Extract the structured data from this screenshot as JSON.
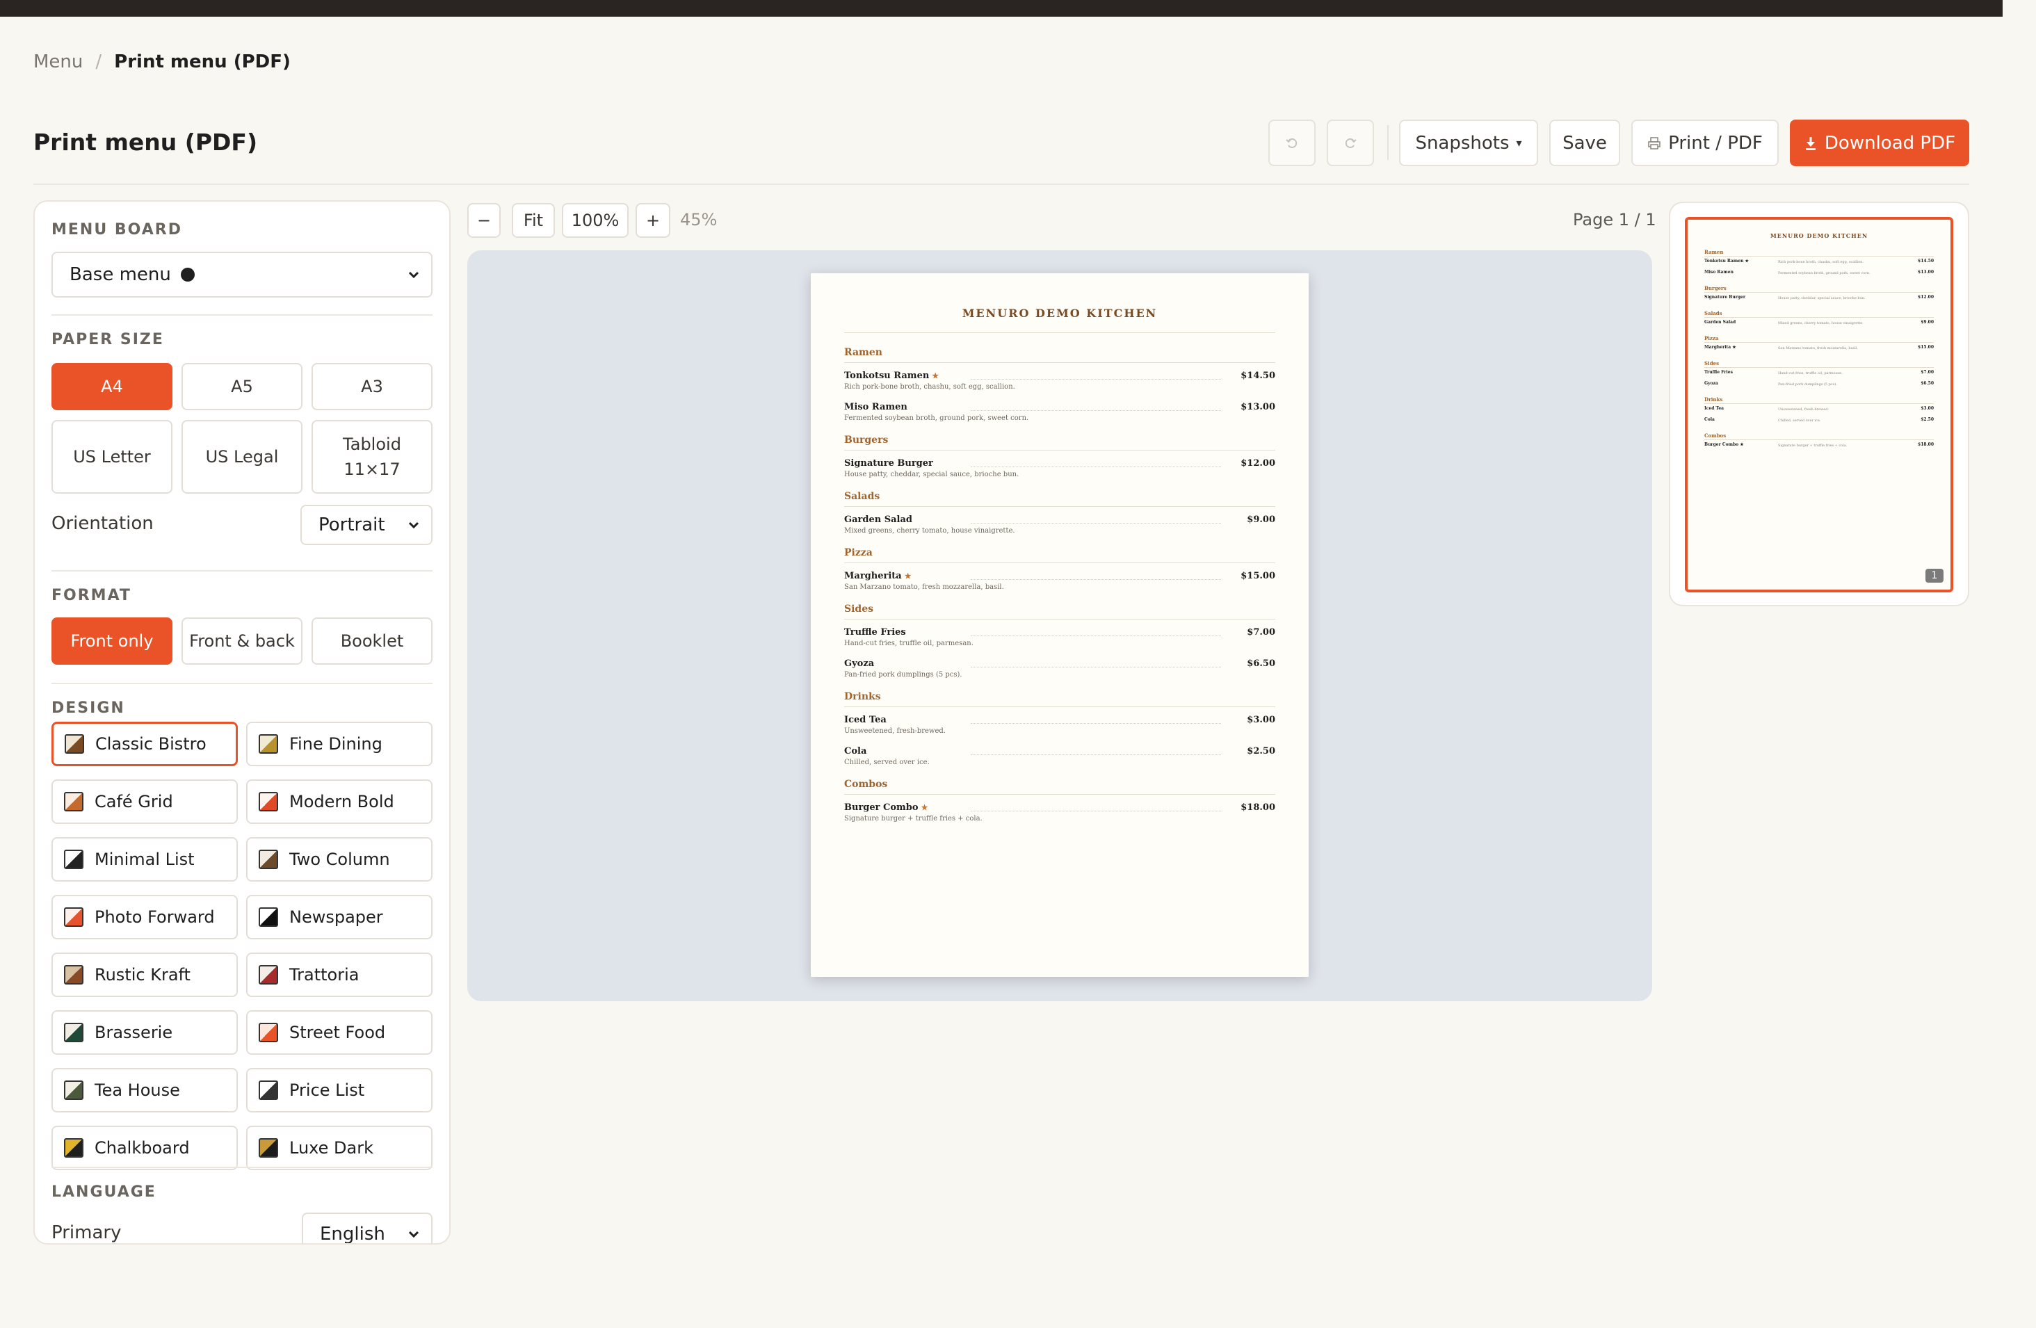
{
  "breadcrumb": {
    "parent": "Menu",
    "separator": "/",
    "current": "Print menu (PDF)"
  },
  "page_title": "Print menu (PDF)",
  "toolbar": {
    "undo_icon": "undo-icon",
    "redo_icon": "redo-icon",
    "snapshots_label": "Snapshots",
    "snapshots_caret": "▾",
    "save_label": "Save",
    "print_label": "Print / PDF",
    "download_label": "Download PDF",
    "accent_color": "#ea5328"
  },
  "sidebar": {
    "menu_board": {
      "label": "MENU BOARD",
      "value": "Base menu"
    },
    "paper_size": {
      "label": "PAPER SIZE",
      "options": [
        "A4",
        "A5",
        "A3",
        "US Letter",
        "US Legal",
        "Tabloid 11×17"
      ],
      "tabloid_line1": "Tabloid",
      "tabloid_line2": "11×17",
      "selected": "A4",
      "orientation_label": "Orientation",
      "orientation_value": "Portrait"
    },
    "format": {
      "label": "FORMAT",
      "options": [
        "Front only",
        "Front & back",
        "Booklet"
      ],
      "selected": "Front only"
    },
    "design": {
      "label": "DESIGN",
      "selected": "Classic Bistro",
      "items": [
        {
          "name": "Classic Bistro",
          "c1": "#7a4a23",
          "c2": "#f1e6d3"
        },
        {
          "name": "Fine Dining",
          "c1": "#b8922c",
          "c2": "#f3ead3"
        },
        {
          "name": "Café Grid",
          "c1": "#c46a2e",
          "c2": "#fbeee0"
        },
        {
          "name": "Modern Bold",
          "c1": "#e24a27",
          "c2": "#fff3ee"
        },
        {
          "name": "Minimal List",
          "c1": "#222222",
          "c2": "#ffffff"
        },
        {
          "name": "Two Column",
          "c1": "#6d4a2a",
          "c2": "#f2ebe1"
        },
        {
          "name": "Photo Forward",
          "c1": "#e6532c",
          "c2": "#fff1ea"
        },
        {
          "name": "Newspaper",
          "c1": "#111111",
          "c2": "#ffffff"
        },
        {
          "name": "Rustic Kraft",
          "c1": "#8b4a26",
          "c2": "#d9c2a2"
        },
        {
          "name": "Trattoria",
          "c1": "#a82b2b",
          "c2": "#f6ece6"
        },
        {
          "name": "Brasserie",
          "c1": "#1f4a38",
          "c2": "#f1ede4"
        },
        {
          "name": "Street Food",
          "c1": "#ea5328",
          "c2": "#fde7dc"
        },
        {
          "name": "Tea House",
          "c1": "#4a5a3a",
          "c2": "#f2efe4"
        },
        {
          "name": "Price List",
          "c1": "#333333",
          "c2": "#ffffff"
        },
        {
          "name": "Chalkboard",
          "c1": "#1f1f1f",
          "c2": "#e0b52b"
        },
        {
          "name": "Luxe Dark",
          "c1": "#1c1c1c",
          "c2": "#c99a3a"
        }
      ]
    },
    "language": {
      "label": "LANGUAGE",
      "primary_label": "Primary",
      "primary_value": "English"
    }
  },
  "preview": {
    "zoom_out": "−",
    "fit": "Fit",
    "zoom_100": "100%",
    "zoom_in": "+",
    "zoom_level": "45%",
    "page_indicator": "Page 1 / 1",
    "thumb_page_number": "1",
    "menu": {
      "title": "MENURO DEMO KITCHEN",
      "sections": [
        {
          "name": "Ramen",
          "items": [
            {
              "name": "Tonkotsu Ramen",
              "star": true,
              "price": "$14.50",
              "desc": "Rich pork-bone broth, chashu, soft egg, scallion."
            },
            {
              "name": "Miso Ramen",
              "star": false,
              "price": "$13.00",
              "desc": "Fermented soybean broth, ground pork, sweet corn."
            }
          ]
        },
        {
          "name": "Burgers",
          "items": [
            {
              "name": "Signature Burger",
              "star": false,
              "price": "$12.00",
              "desc": "House patty, cheddar, special sauce, brioche bun."
            }
          ]
        },
        {
          "name": "Salads",
          "items": [
            {
              "name": "Garden Salad",
              "star": false,
              "price": "$9.00",
              "desc": "Mixed greens, cherry tomato, house vinaigrette."
            }
          ]
        },
        {
          "name": "Pizza",
          "items": [
            {
              "name": "Margherita",
              "star": true,
              "price": "$15.00",
              "desc": "San Marzano tomato, fresh mozzarella, basil."
            }
          ]
        },
        {
          "name": "Sides",
          "items": [
            {
              "name": "Truffle Fries",
              "star": false,
              "price": "$7.00",
              "desc": "Hand-cut fries, truffle oil, parmesan."
            },
            {
              "name": "Gyoza",
              "star": false,
              "price": "$6.50",
              "desc": "Pan-fried pork dumplings (5 pcs)."
            }
          ]
        },
        {
          "name": "Drinks",
          "items": [
            {
              "name": "Iced Tea",
              "star": false,
              "price": "$3.00",
              "desc": "Unsweetened, fresh-brewed."
            },
            {
              "name": "Cola",
              "star": false,
              "price": "$2.50",
              "desc": "Chilled, served over ice."
            }
          ]
        },
        {
          "name": "Combos",
          "items": [
            {
              "name": "Burger Combo",
              "star": true,
              "price": "$18.00",
              "desc": "Signature burger + truffle fries + cola."
            }
          ]
        }
      ]
    }
  }
}
